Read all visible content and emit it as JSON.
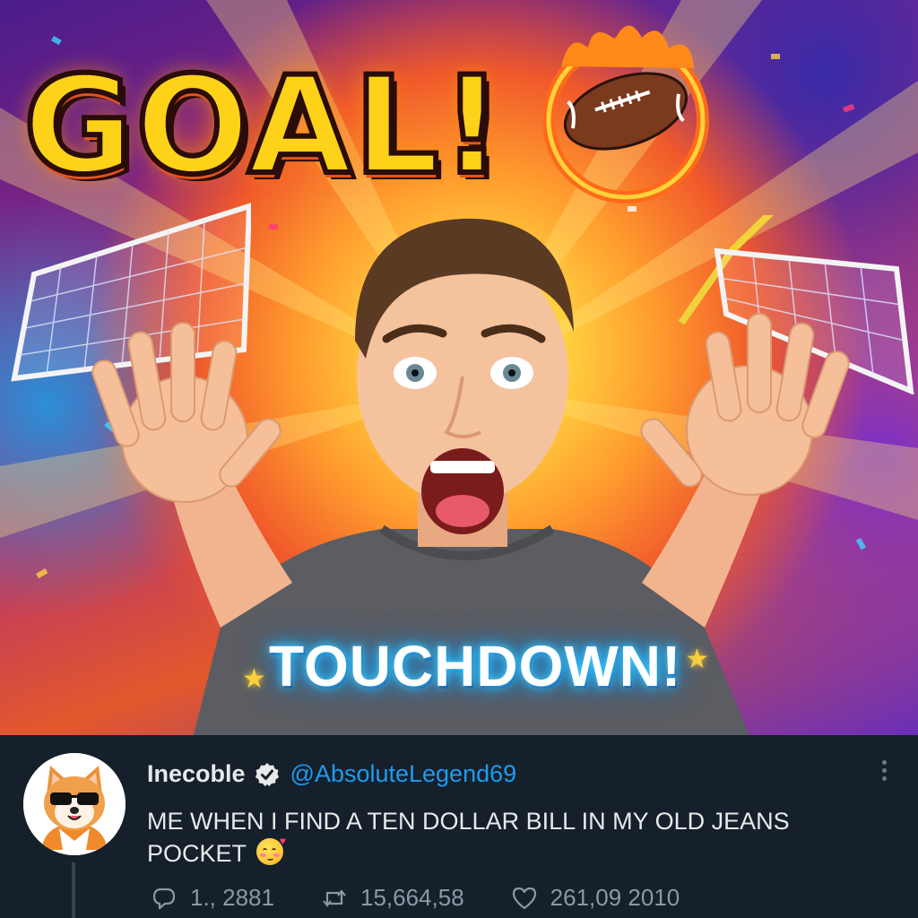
{
  "media": {
    "headline": "GOAL!",
    "shirt_text": "TOUCHDOWN!"
  },
  "tweet": {
    "display_name": "Inecoble",
    "handle": "@AbsoluteLegend69",
    "text": "ME WHEN I FIND A TEN DOLLAR BILL IN MY OLD JEANS POCKET",
    "emoji": "smiling-face-with-hearts",
    "avatar": "corgi-sunglasses-avatar",
    "accent_color": "#1d9bf0",
    "actions": {
      "reply_count": "1., 2881",
      "retweet_count": "15,664,58",
      "like_count": "261,09 2010"
    }
  }
}
